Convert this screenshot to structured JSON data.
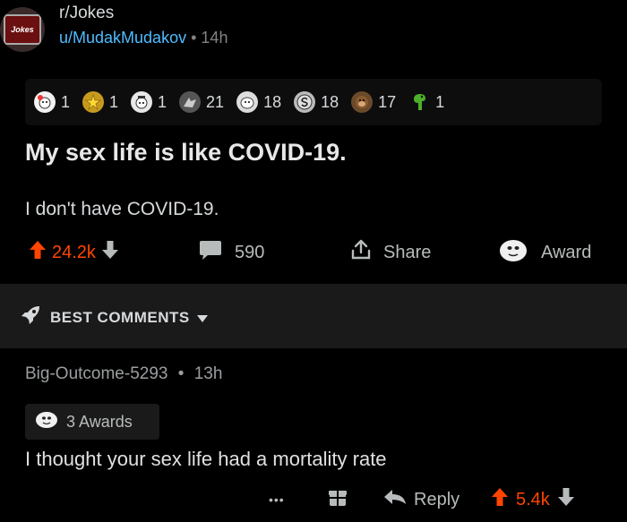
{
  "post": {
    "subreddit": "r/Jokes",
    "subreddit_icon_text": "Jokes",
    "author": "u/MudakMudakov",
    "dot": "•",
    "age": "14h",
    "awards": [
      {
        "icon": "wholesome-award-icon",
        "count": "1"
      },
      {
        "icon": "star-award-icon",
        "count": "1"
      },
      {
        "icon": "helpful-award-icon",
        "count": "1"
      },
      {
        "icon": "hugs-award-icon",
        "count": "21"
      },
      {
        "icon": "silver-award-icon",
        "count": "18"
      },
      {
        "icon": "s-coin-award-icon",
        "count": "18"
      },
      {
        "icon": "ape-award-icon",
        "count": "17"
      },
      {
        "icon": "dino-award-icon",
        "count": "1"
      }
    ],
    "title": "My sex life is like COVID-19.",
    "body": "I don't have COVID-19.",
    "score": "24.2k",
    "comments": "590",
    "share_label": "Share",
    "award_label": "Award"
  },
  "sort": {
    "label": "BEST COMMENTS"
  },
  "comment": {
    "author": "Big-Outcome-5293",
    "dot": "•",
    "age": "13h",
    "awards_label": "3 Awards",
    "text": "I thought your sex life had a mortality rate",
    "more": "•••",
    "reply_label": "Reply",
    "score": "5.4k"
  },
  "colors": {
    "upvote": "#ff4500",
    "link": "#4fbcff",
    "background": "#000000",
    "panel": "#1a1a1b"
  }
}
